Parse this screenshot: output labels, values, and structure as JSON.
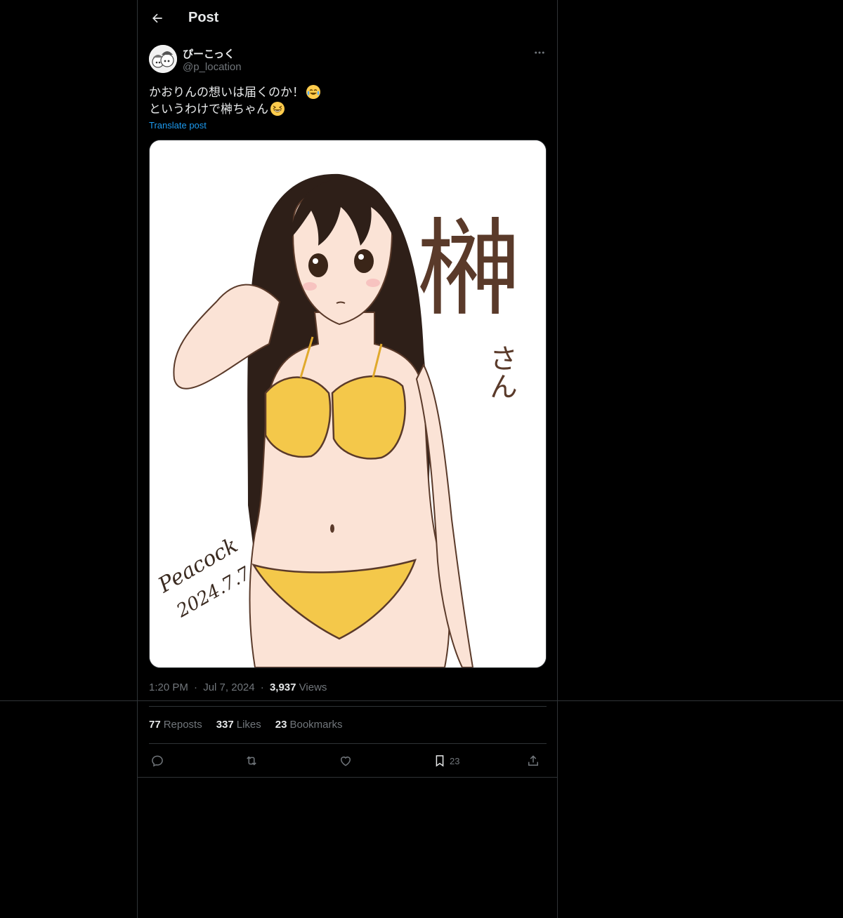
{
  "header": {
    "title": "Post"
  },
  "author": {
    "display_name": "ぴーこっく",
    "handle": "@p_location"
  },
  "post": {
    "line1": "かおりんの想いは届くのか！",
    "line2": "というわけで榊ちゃん",
    "translate_label": "Translate post"
  },
  "image": {
    "title_kanji": "榊",
    "title_kana": "さん",
    "signature": "Peacock",
    "signature_date": "2024.7.7"
  },
  "meta": {
    "time": "1:20 PM",
    "dot": "·",
    "date": "Jul 7, 2024",
    "views_count": "3,937",
    "views_label": "Views"
  },
  "stats": {
    "reposts_count": "77",
    "reposts_label": "Reposts",
    "likes_count": "337",
    "likes_label": "Likes",
    "bookmarks_count": "23",
    "bookmarks_label": "Bookmarks"
  },
  "actions": {
    "bookmark_count": "23"
  },
  "icons": {
    "back": "arrow-left-icon",
    "more": "more-horizontal-icon",
    "reply": "reply-icon",
    "repost": "repost-icon",
    "like": "heart-icon",
    "bookmark": "bookmark-icon",
    "share": "share-icon"
  },
  "colors": {
    "background": "#000000",
    "text": "#e7e9ea",
    "muted": "#71767b",
    "link": "#1d9bf0",
    "border": "#2f3336"
  }
}
